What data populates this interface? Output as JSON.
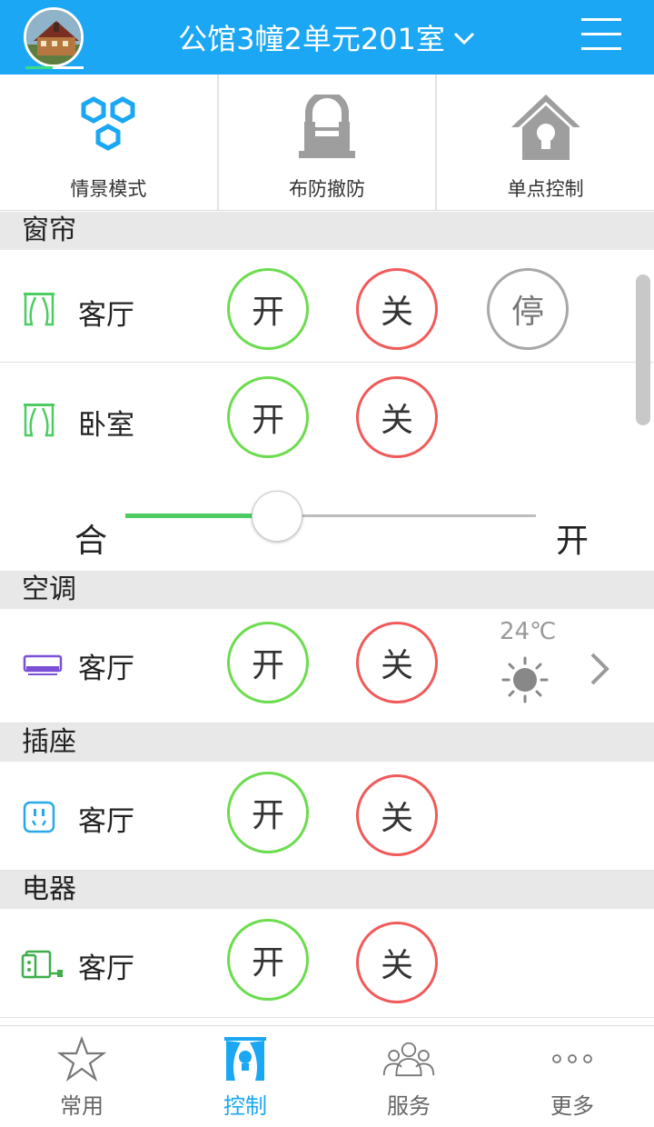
{
  "header": {
    "title": "公馆3幢2单元201室",
    "title_chevron_icon": "chevron-down-icon",
    "menu_icon": "hamburger-menu-icon"
  },
  "tiles": [
    {
      "label": "情景模式",
      "icon": "hexagons-icon",
      "color": "#1ba7f3"
    },
    {
      "label": "布防撤防",
      "icon": "lock-icon",
      "color": "#999999"
    },
    {
      "label": "单点控制",
      "icon": "house-bulb-icon",
      "color": "#999999"
    }
  ],
  "sections": {
    "curtain": "窗帘",
    "ac": "空调",
    "socket": "插座",
    "appliance": "电器"
  },
  "rows": {
    "curtain_living": {
      "name": "客厅",
      "on": "开",
      "off": "关",
      "stop": "停"
    },
    "curtain_bedroom": {
      "name": "卧室",
      "on": "开",
      "off": "关"
    },
    "ac_living": {
      "name": "客厅",
      "on": "开",
      "off": "关",
      "temperature": "24℃"
    },
    "socket_living": {
      "name": "客厅",
      "on": "开",
      "off": "关"
    },
    "appliance_living": {
      "name": "客厅",
      "on": "开",
      "off": "关"
    }
  },
  "slider": {
    "left_label": "合",
    "right_label": "开",
    "value": 0.37
  },
  "bottom_nav": [
    {
      "label": "常用",
      "icon": "star-icon",
      "active": false
    },
    {
      "label": "控制",
      "icon": "curtain-bulb-icon",
      "active": true
    },
    {
      "label": "服务",
      "icon": "people-icon",
      "active": false
    },
    {
      "label": "更多",
      "icon": "more-dots-icon",
      "active": false
    }
  ],
  "colors": {
    "brand": "#1ba7f3",
    "on": "#6cdc4f",
    "off": "#f05a5a",
    "stop": "#a8a8a8",
    "slider_fill": "#4ccc63"
  }
}
